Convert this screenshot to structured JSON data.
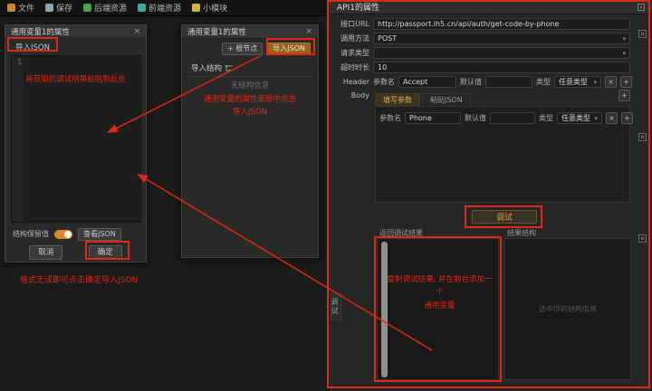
{
  "colors": {
    "annotation": "#e12717",
    "accent_orange": "#d9892b",
    "accent_button": "#96621d"
  },
  "icons": {
    "close": "×",
    "remove": "×",
    "add": "+",
    "chevron": "▾",
    "add_root_plus": "+"
  },
  "menubar": {
    "items": [
      {
        "label": "文件",
        "icon": "file-icon"
      },
      {
        "label": "保存",
        "icon": "save-icon"
      },
      {
        "label": "后端资源",
        "icon": "backend-resources-icon"
      },
      {
        "label": "前端资源",
        "icon": "frontend-resources-icon"
      },
      {
        "label": "小模块",
        "icon": "module-icon"
      }
    ]
  },
  "import_dialog": {
    "title": "通用变量1的属性",
    "section_label": "导入JSON",
    "line_number": "1",
    "toggle_label": "结构保留值",
    "view_json": "查看JSON",
    "cancel": "取消",
    "confirm": "确定"
  },
  "props_dialog": {
    "title": "通用变量1的属性",
    "add_root": "+ 根节点",
    "import_json": "导入JSON",
    "import_structure": "导入结构",
    "empty": "无结构信息"
  },
  "api_panel": {
    "title": "API1的属性",
    "rows": {
      "url_label": "接口URL",
      "url_value": "http://passport.ih5.cn/api/auth/get-code-by-phone",
      "method_label": "调用方法",
      "method_value": "POST",
      "req_type_label": "请求类型",
      "req_type_value": "",
      "timeout_label": "超时时长",
      "timeout_value": "10",
      "header_label": "Header",
      "body_label": "Body"
    },
    "header_row": {
      "param_label": "参数名",
      "param_value": "Accept",
      "default_label": "默认值",
      "default_value": "",
      "type_label": "类型",
      "type_value": "任意类型"
    },
    "tabs": [
      {
        "label": "填写参数",
        "active": true
      },
      {
        "label": "粘贴JSON",
        "active": false
      }
    ],
    "param_row": {
      "param_label": "参数名",
      "param_value": "Phone",
      "default_label": "默认值",
      "default_value": "",
      "type_label": "类型",
      "type_value": "任意类型"
    },
    "debug_button": "调试",
    "results": {
      "left_title": "返回调试结果",
      "right_title": "结果结构",
      "placeholder": "选中项的结构信息"
    },
    "side_tab": "调试"
  },
  "annotations": {
    "editor_hint": "将获取的调试结果粘贴到此处",
    "panel_hint_line1": "通用变量的属性面板中点击",
    "panel_hint_line2": "导入JSON",
    "bottom_hint": "格式无误即可点击确定导入JSON",
    "result_hint_line1": "复制调试结果, 并在前台添加一个",
    "result_hint_line2": "通用变量"
  }
}
